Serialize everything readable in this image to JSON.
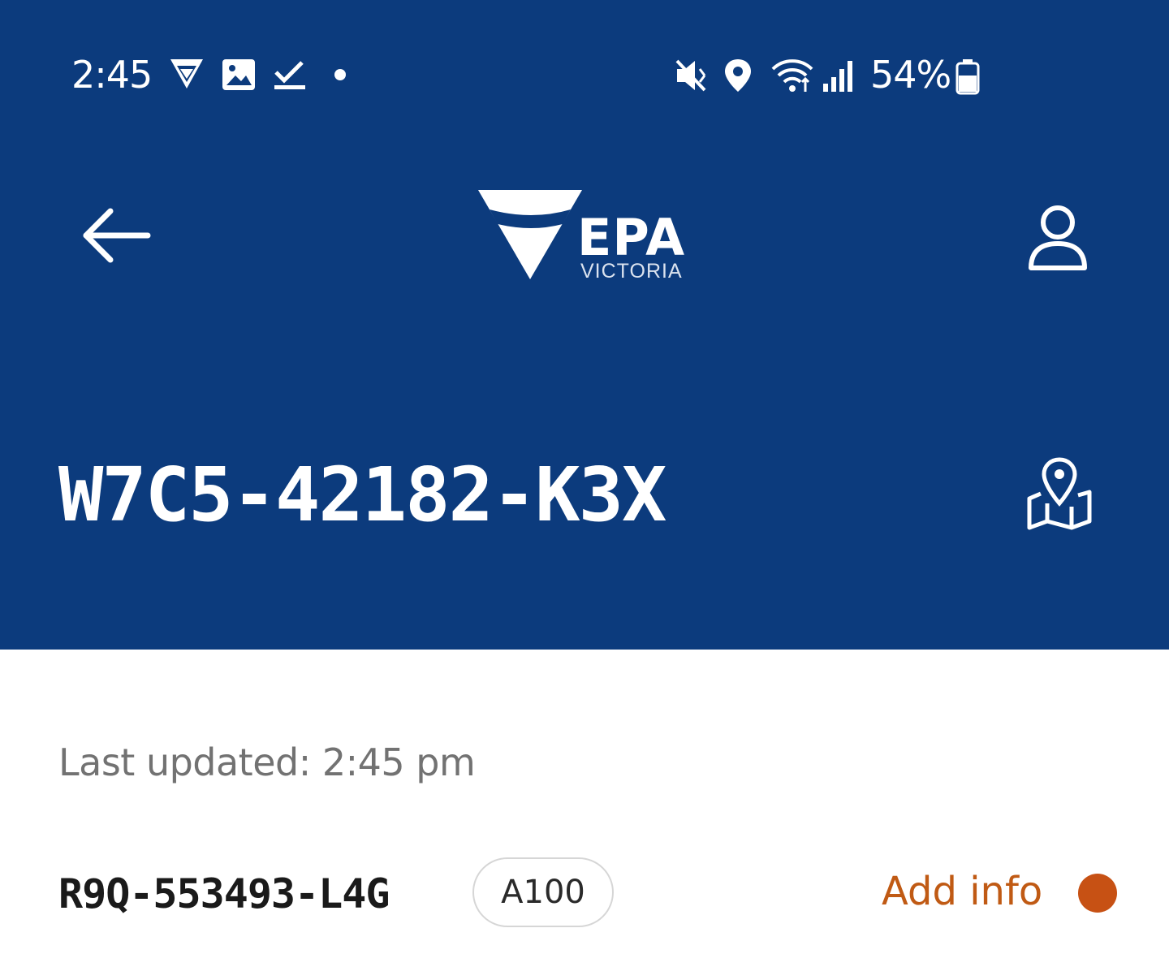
{
  "status_bar": {
    "time": "2:45",
    "battery_percent": "54%",
    "icons": [
      "download-notification-icon",
      "image-icon",
      "checklist-icon",
      "dot-icon",
      "vibrate-mute-icon",
      "location-icon",
      "wifi-icon",
      "signal-icon",
      "battery-icon"
    ]
  },
  "header": {
    "background_color": "#0c3b7d",
    "logo_text": "EPA",
    "logo_subtext": "VICTORIA",
    "title": "W7C5-42182-K3X",
    "back_icon": "arrow-left-icon",
    "profile_icon": "user-icon",
    "map_icon": "map-pin-icon"
  },
  "content": {
    "last_updated": "Last updated: 2:45 pm",
    "item": {
      "id": "R9Q-553493-L4G",
      "badge": "A100",
      "action_label": "Add info",
      "action_color": "#c05a14"
    }
  }
}
